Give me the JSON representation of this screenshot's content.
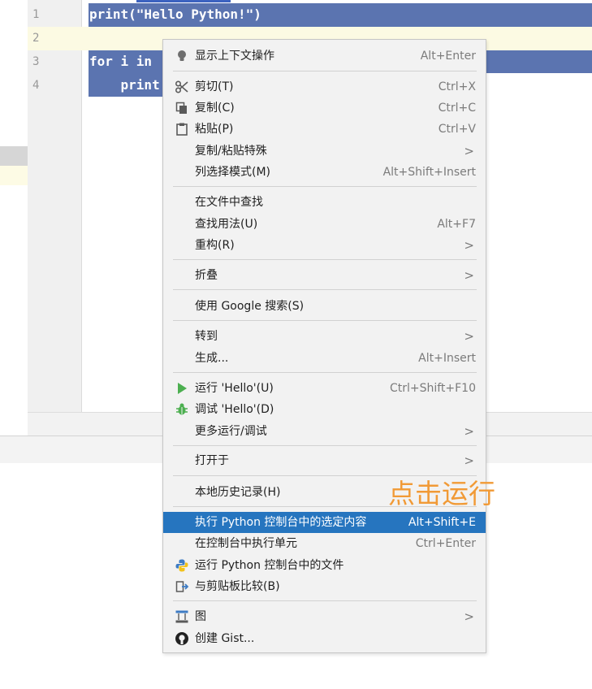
{
  "editor": {
    "line_numbers": [
      "1",
      "2",
      "3",
      "4"
    ],
    "code_lines": [
      "print(\"Hello Python!\")",
      "",
      "for i in",
      "    print"
    ]
  },
  "context_menu": {
    "items": [
      {
        "label": "显示上下文操作",
        "shortcut": "Alt+Enter",
        "icon": "lightbulb-icon"
      },
      {
        "label": "剪切(T)",
        "shortcut": "Ctrl+X",
        "icon": "scissors-icon"
      },
      {
        "label": "复制(C)",
        "shortcut": "Ctrl+C",
        "icon": "copy-icon"
      },
      {
        "label": "粘贴(P)",
        "shortcut": "Ctrl+V",
        "icon": "clipboard-icon"
      },
      {
        "label": "复制/粘贴特殊",
        "shortcut": ">",
        "icon": ""
      },
      {
        "label": "列选择模式(M)",
        "shortcut": "Alt+Shift+Insert",
        "icon": ""
      },
      {
        "label": "在文件中查找",
        "shortcut": "",
        "icon": ""
      },
      {
        "label": "查找用法(U)",
        "shortcut": "Alt+F7",
        "icon": ""
      },
      {
        "label": "重构(R)",
        "shortcut": ">",
        "icon": ""
      },
      {
        "label": "折叠",
        "shortcut": ">",
        "icon": ""
      },
      {
        "label": "使用 Google 搜索(S)",
        "shortcut": "",
        "icon": ""
      },
      {
        "label": "转到",
        "shortcut": ">",
        "icon": ""
      },
      {
        "label": "生成...",
        "shortcut": "Alt+Insert",
        "icon": ""
      },
      {
        "label": "运行 'Hello'(U)",
        "shortcut": "Ctrl+Shift+F10",
        "icon": "run-icon"
      },
      {
        "label": "调试 'Hello'(D)",
        "shortcut": "",
        "icon": "debug-icon"
      },
      {
        "label": "更多运行/调试",
        "shortcut": ">",
        "icon": ""
      },
      {
        "label": "打开于",
        "shortcut": ">",
        "icon": ""
      },
      {
        "label": "本地历史记录(H)",
        "shortcut": "",
        "icon": ""
      },
      {
        "label": "执行 Python 控制台中的选定内容",
        "shortcut": "Alt+Shift+E",
        "icon": ""
      },
      {
        "label": "在控制台中执行单元",
        "shortcut": "Ctrl+Enter",
        "icon": ""
      },
      {
        "label": "运行 Python 控制台中的文件",
        "shortcut": "",
        "icon": "python-icon"
      },
      {
        "label": "与剪贴板比较(B)",
        "shortcut": "",
        "icon": "compare-icon"
      },
      {
        "label": "图",
        "shortcut": ">",
        "icon": "diagram-icon"
      },
      {
        "label": "创建 Gist...",
        "shortcut": "",
        "icon": "github-icon"
      }
    ],
    "selected_color": "#2675bf"
  },
  "annotation": {
    "text": "点击运行",
    "color": "#f19a36"
  }
}
